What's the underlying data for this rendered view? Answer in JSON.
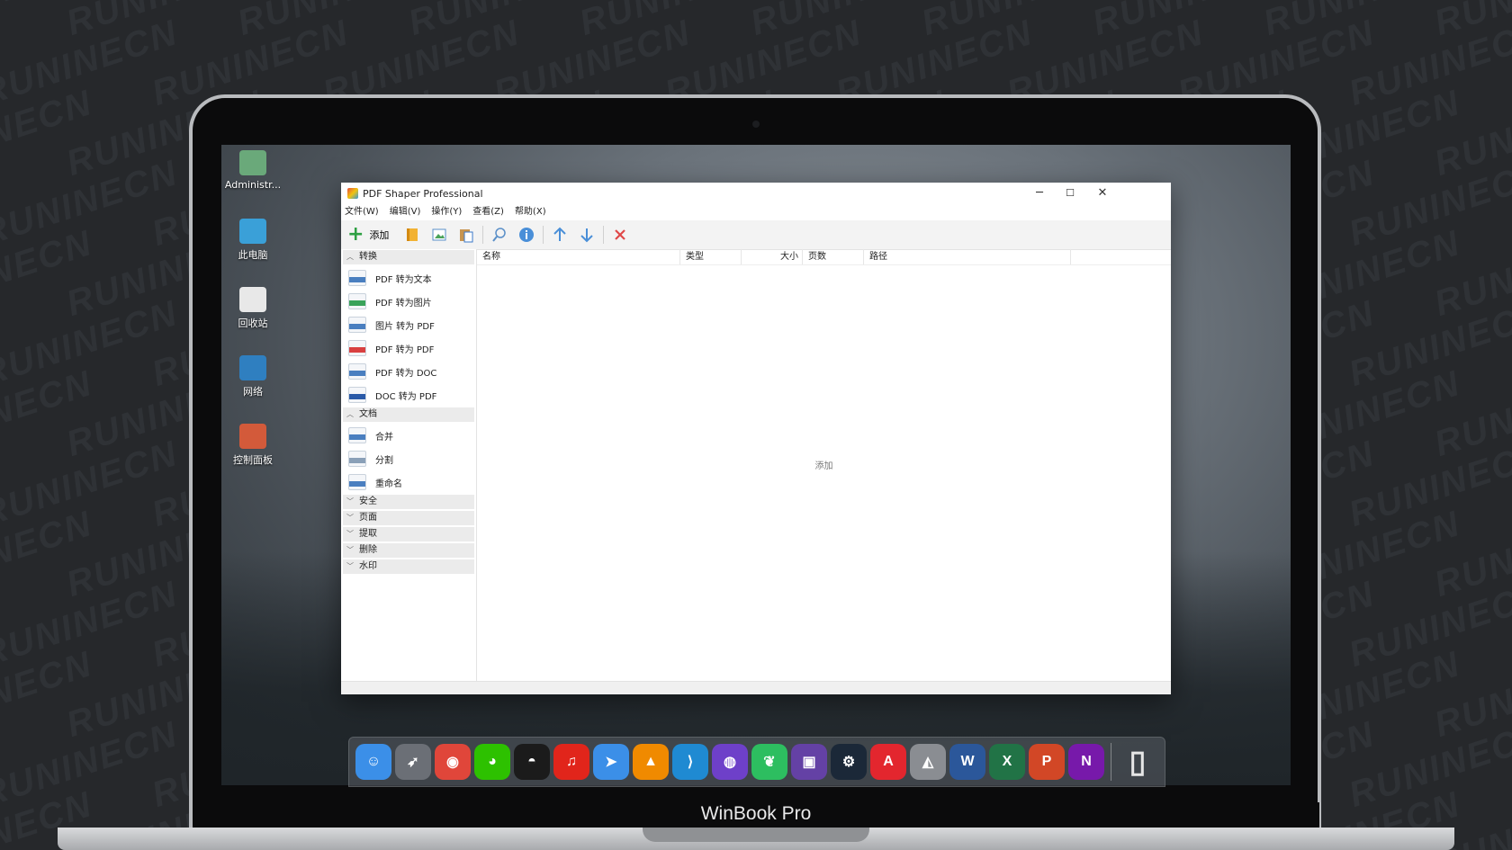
{
  "watermark_text": "RUNINECN",
  "laptop": {
    "brand": "WinBook Pro"
  },
  "desktop_icons": [
    {
      "label": "Administr...",
      "icon": "user-icon",
      "color": "#6aa97a"
    },
    {
      "label": "此电脑",
      "icon": "computer-icon",
      "color": "#3aa0d8"
    },
    {
      "label": "回收站",
      "icon": "recycle-bin-icon",
      "color": "#e8e8e8"
    },
    {
      "label": "网络",
      "icon": "network-icon",
      "color": "#2f7fc0"
    },
    {
      "label": "控制面板",
      "icon": "control-panel-icon",
      "color": "#d35a3a"
    }
  ],
  "window": {
    "title": "PDF Shaper Professional",
    "controls": {
      "minimize": "─",
      "maximize": "☐",
      "close": "✕"
    },
    "menu": [
      "文件(W)",
      "编辑(V)",
      "操作(Y)",
      "查看(Z)",
      "帮助(X)"
    ],
    "toolbar": {
      "add_label": "添加",
      "buttons": [
        "book-icon",
        "image-icon",
        "paste-icon",
        "search-icon",
        "info-icon",
        "arrow-up-icon",
        "arrow-down-icon",
        "delete-icon"
      ]
    },
    "sidebar": {
      "groups": [
        {
          "label": "转换",
          "expanded": true,
          "items": [
            {
              "label": "PDF 转为文本",
              "icon": "txt-file-icon",
              "color": "#4a7fc0"
            },
            {
              "label": "PDF 转为图片",
              "icon": "jpg-file-icon",
              "color": "#3aa35a"
            },
            {
              "label": "图片 转为 PDF",
              "icon": "image-file-icon",
              "color": "#4a7fc0"
            },
            {
              "label": "PDF 转为 PDF",
              "icon": "pdf-file-icon",
              "color": "#d94040"
            },
            {
              "label": "PDF 转为 DOC",
              "icon": "doc-file-icon",
              "color": "#4a7fc0"
            },
            {
              "label": "DOC 转为 PDF",
              "icon": "word-file-icon",
              "color": "#2a5aa8"
            }
          ]
        },
        {
          "label": "文档",
          "expanded": true,
          "items": [
            {
              "label": "合并",
              "icon": "merge-icon",
              "color": "#4a7fc0"
            },
            {
              "label": "分割",
              "icon": "split-icon",
              "color": "#8aa0b8"
            },
            {
              "label": "重命名",
              "icon": "rename-icon",
              "color": "#4a7fc0"
            }
          ]
        },
        {
          "label": "安全",
          "expanded": false,
          "items": []
        },
        {
          "label": "页面",
          "expanded": false,
          "items": []
        },
        {
          "label": "提取",
          "expanded": false,
          "items": []
        },
        {
          "label": "删除",
          "expanded": false,
          "items": []
        },
        {
          "label": "水印",
          "expanded": false,
          "items": []
        }
      ]
    },
    "table": {
      "columns": [
        "名称",
        "类型",
        "大小",
        "页数",
        "路径"
      ]
    },
    "empty_hint": "添加"
  },
  "dock": [
    {
      "icon": "finder-icon",
      "color": "#3b8fe8",
      "glyph": "☺"
    },
    {
      "icon": "launchpad-icon",
      "color": "#6b6f76",
      "glyph": "➶"
    },
    {
      "icon": "chrome-icon",
      "color": "#e0463a",
      "glyph": "◉"
    },
    {
      "icon": "wechat-icon",
      "color": "#2dc100",
      "glyph": "◕"
    },
    {
      "icon": "qq-icon",
      "color": "#1b1b1b",
      "glyph": "◓"
    },
    {
      "icon": "netease-music-icon",
      "color": "#e1251b",
      "glyph": "♫"
    },
    {
      "icon": "feishu-icon",
      "color": "#3b8fe8",
      "glyph": "➤"
    },
    {
      "icon": "vlc-icon",
      "color": "#f08a00",
      "glyph": "▲"
    },
    {
      "icon": "vscode-icon",
      "color": "#1f8ad2",
      "glyph": "⟩"
    },
    {
      "icon": "github-icon",
      "color": "#6e40c9",
      "glyph": "◍"
    },
    {
      "icon": "evernote-icon",
      "color": "#2dbe60",
      "glyph": "❦"
    },
    {
      "icon": "twitch-icon",
      "color": "#6441a5",
      "glyph": "▣"
    },
    {
      "icon": "steam-icon",
      "color": "#1b2838",
      "glyph": "⚙"
    },
    {
      "icon": "acrobat-icon",
      "color": "#e3262e",
      "glyph": "A"
    },
    {
      "icon": "rhino-icon",
      "color": "#8a8d92",
      "glyph": "◭"
    },
    {
      "icon": "word-icon",
      "color": "#2b579a",
      "glyph": "W"
    },
    {
      "icon": "excel-icon",
      "color": "#217346",
      "glyph": "X"
    },
    {
      "icon": "powerpoint-icon",
      "color": "#d24726",
      "glyph": "P"
    },
    {
      "icon": "onenote-icon",
      "color": "#7719aa",
      "glyph": "N"
    }
  ],
  "dock_trash": {
    "icon": "trash-icon",
    "color": "#e6e6e6",
    "glyph": "▯"
  }
}
